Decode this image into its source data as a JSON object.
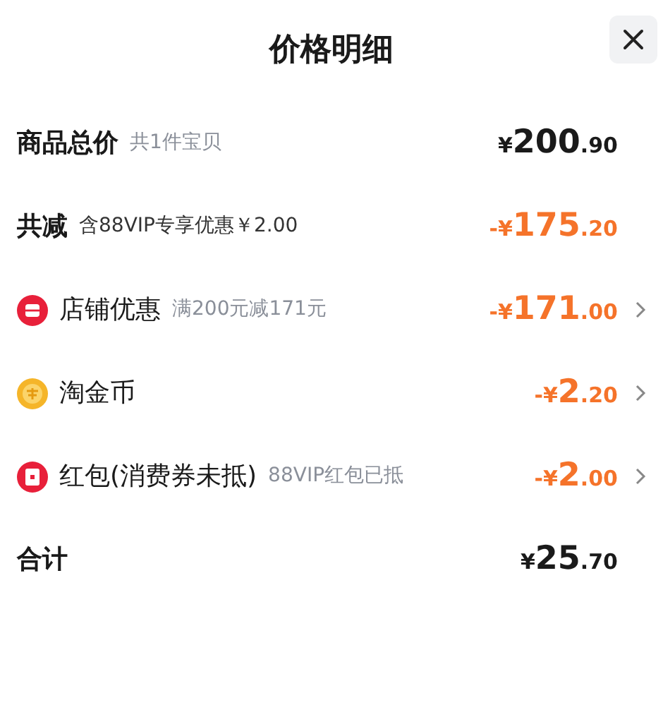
{
  "title": "价格明细",
  "rows": [
    {
      "kind": "summary",
      "label": "商品总价",
      "note": "共1件宝贝",
      "currency": "¥",
      "whole": "200",
      "fraction": ".90",
      "discount": false,
      "chevron": false
    },
    {
      "kind": "summary",
      "label": "共减",
      "note": "含88VIP专享优惠￥2.00",
      "currency": "-¥",
      "whole": "175",
      "fraction": ".20",
      "discount": true,
      "chevron": false
    },
    {
      "kind": "store_discount",
      "label": "店铺优惠",
      "note": "满200元减171元",
      "currency": "-¥",
      "whole": "171",
      "fraction": ".00",
      "discount": true,
      "chevron": true
    },
    {
      "kind": "coins",
      "label": "淘金币",
      "currency": "-¥",
      "whole": "2",
      "fraction": ".20",
      "discount": true,
      "chevron": true
    },
    {
      "kind": "red_packet",
      "label": "红包(消费券未抵)",
      "note": "88VIP红包已抵",
      "currency": "-¥",
      "whole": "2",
      "fraction": ".00",
      "discount": true,
      "chevron": true
    },
    {
      "kind": "summary",
      "label": "合计",
      "currency": "¥",
      "whole": "25",
      "fraction": ".70",
      "discount": false,
      "chevron": false
    }
  ]
}
